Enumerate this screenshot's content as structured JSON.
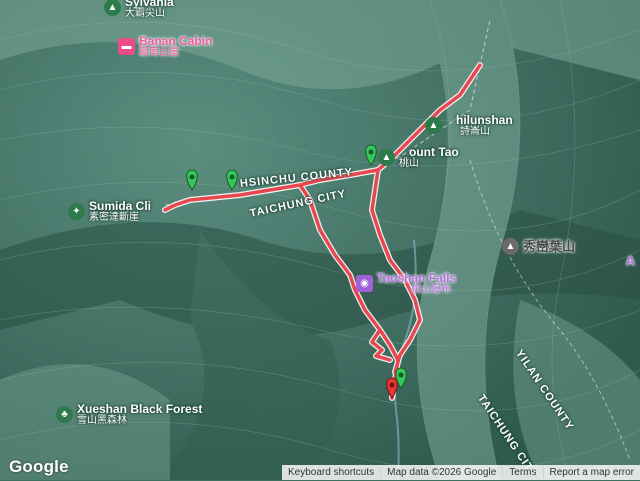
{
  "colors": {
    "route": "#e8474f",
    "route_edge": "#ffffff",
    "terrain": "#4a7c6e",
    "pin_green": "#34c759",
    "pin_red": "#e53935",
    "poi_green": "#2d7a4a",
    "poi_pink": "#ea4c89",
    "poi_purple": "#a060d8",
    "poi_gray": "#6b6b6b"
  },
  "places": {
    "sylvania": {
      "en": "Sylvania",
      "zh": "大霸尖山",
      "icon": "mountain-icon"
    },
    "banan_cabin": {
      "en": "Banan Cabin",
      "zh": "霸南山屋",
      "icon": "lodging-icon"
    },
    "sumida": {
      "en": "Sumida Cli",
      "zh": "素密達斷崖",
      "icon": "viewpoint-icon"
    },
    "shilunshan": {
      "en": "hilunshan",
      "zh": "詩崙山",
      "icon": "mountain-icon"
    },
    "mount_tao": {
      "en": "ount Tao",
      "zh": "桃山",
      "icon": "mountain-icon"
    },
    "taoshan_falls": {
      "en": "Taoshan Falls",
      "zh": "桃山瀑布",
      "icon": "waterfall-icon"
    },
    "xiuluye": {
      "en": "",
      "zh": "秀巒葉山",
      "icon": "mountain-icon"
    },
    "xueshan_forest": {
      "en": "Xueshan Black Forest",
      "zh": "雪山黑森林",
      "icon": "tree-icon"
    },
    "edge_a": {
      "en": "A",
      "zh": ""
    }
  },
  "counties": {
    "hsinchu": "HSINCHU COUNTY",
    "taichung_top": "TAICHUNG CITY",
    "yilan": "YILAN COUNTY",
    "taichung_bottom": "TAICHUNG CITY"
  },
  "footer": {
    "google": "Google",
    "keyboard": "Keyboard shortcuts",
    "mapdata": "Map data ©2026 Google",
    "terms": "Terms",
    "report": "Report a map error"
  }
}
